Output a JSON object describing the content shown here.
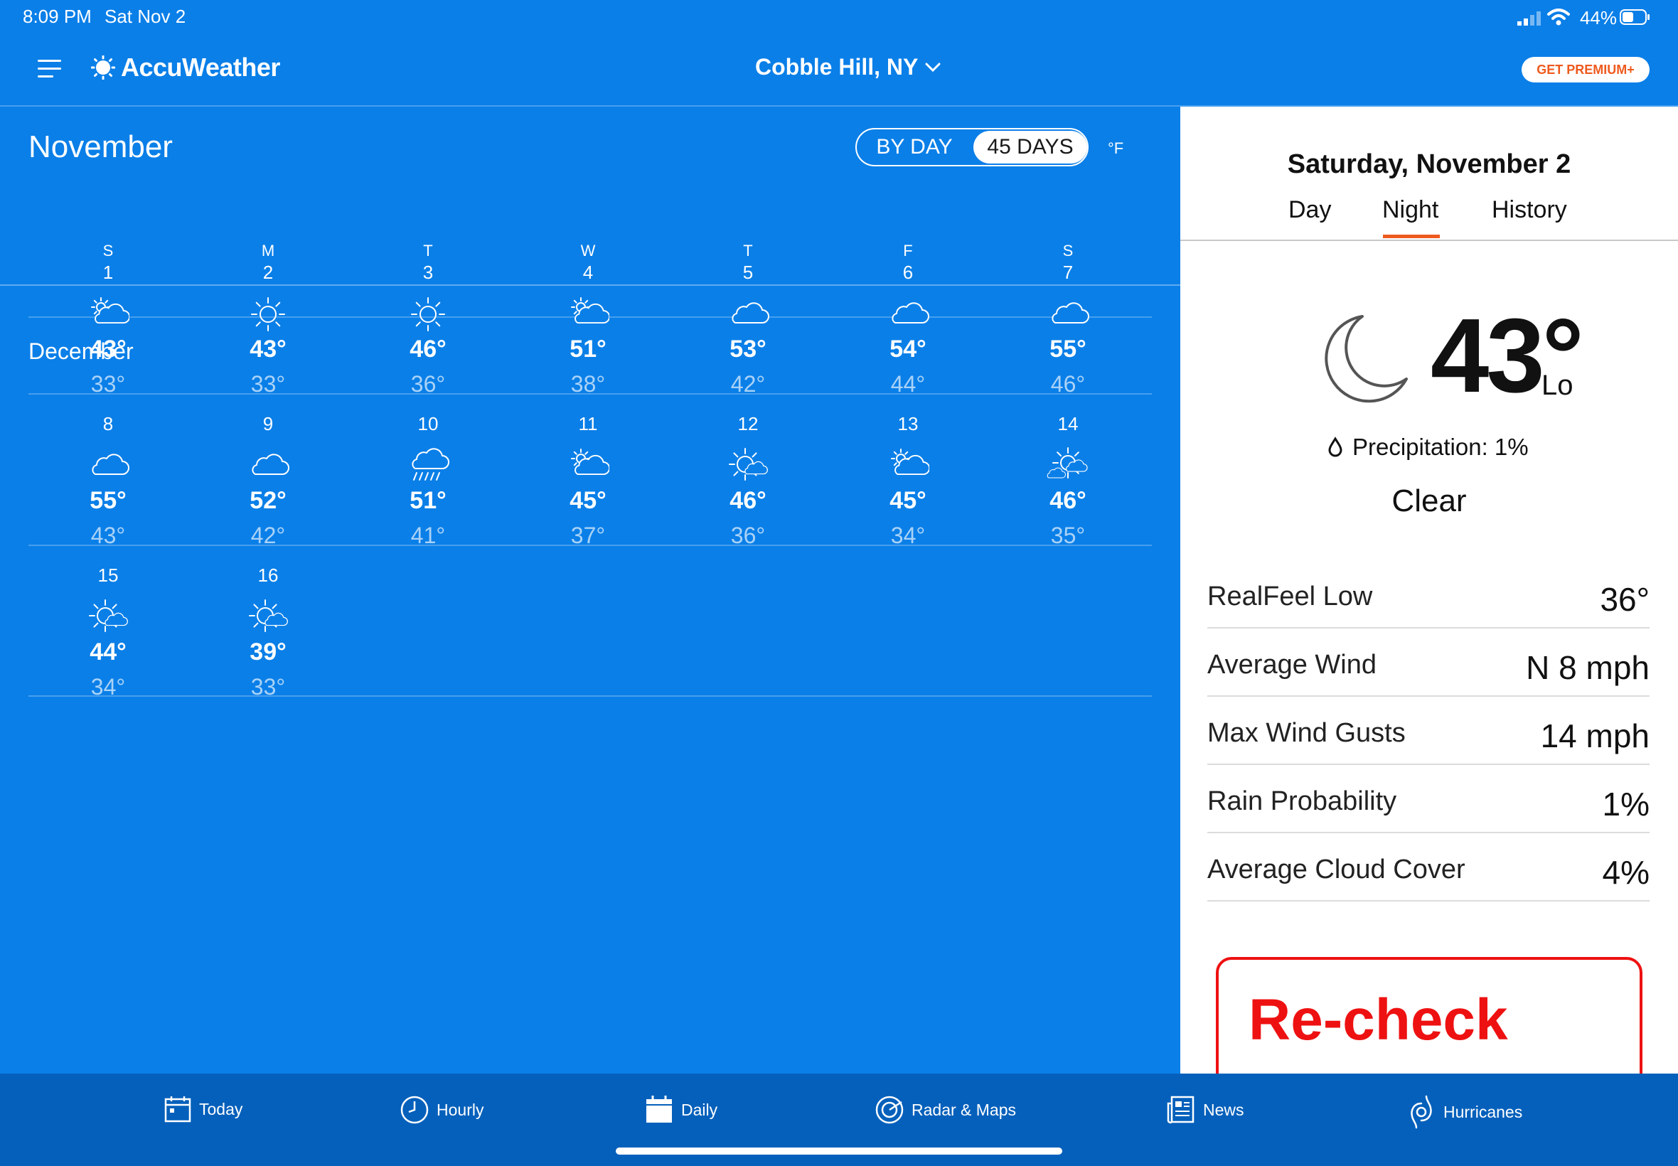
{
  "status_bar": {
    "time": "8:09 PM",
    "date": "Sat Nov 2",
    "battery": "44%"
  },
  "header": {
    "brand": "AccuWeather",
    "location": "Cobble Hill, NY",
    "premium_label": "GET PREMIUM+"
  },
  "calendar": {
    "month_title": "November",
    "toggle": {
      "by_day": "BY DAY",
      "days45": "45 DAYS",
      "selected": "45 DAYS"
    },
    "unit": "°F",
    "weekdays": [
      "S",
      "M",
      "T",
      "W",
      "T",
      "F",
      "S"
    ],
    "december_title": "December",
    "days": [
      {
        "day": "1",
        "icon": "partly-cloudy-icon",
        "hi": "43°",
        "lo": "33°"
      },
      {
        "day": "2",
        "icon": "sunny-icon",
        "hi": "43°",
        "lo": "33°"
      },
      {
        "day": "3",
        "icon": "sunny-icon",
        "hi": "46°",
        "lo": "36°"
      },
      {
        "day": "4",
        "icon": "partly-cloudy-icon",
        "hi": "51°",
        "lo": "38°"
      },
      {
        "day": "5",
        "icon": "cloudy-icon",
        "hi": "53°",
        "lo": "42°"
      },
      {
        "day": "6",
        "icon": "cloudy-icon",
        "hi": "54°",
        "lo": "44°"
      },
      {
        "day": "7",
        "icon": "cloudy-icon",
        "hi": "55°",
        "lo": "46°"
      },
      {
        "day": "8",
        "icon": "cloudy-icon",
        "hi": "55°",
        "lo": "43°"
      },
      {
        "day": "9",
        "icon": "cloudy-icon",
        "hi": "52°",
        "lo": "42°"
      },
      {
        "day": "10",
        "icon": "rain-icon",
        "hi": "51°",
        "lo": "41°"
      },
      {
        "day": "11",
        "icon": "partly-cloudy-icon",
        "hi": "45°",
        "lo": "37°"
      },
      {
        "day": "12",
        "icon": "mostly-sunny-icon",
        "hi": "46°",
        "lo": "36°"
      },
      {
        "day": "13",
        "icon": "partly-cloudy-icon",
        "hi": "45°",
        "lo": "34°"
      },
      {
        "day": "14",
        "icon": "sun-clouds-icon",
        "hi": "46°",
        "lo": "35°"
      },
      {
        "day": "15",
        "icon": "mostly-sunny-icon",
        "hi": "44°",
        "lo": "34°"
      },
      {
        "day": "16",
        "icon": "mostly-sunny-icon",
        "hi": "39°",
        "lo": "33°"
      }
    ]
  },
  "detail": {
    "date": "Saturday, November 2",
    "tabs": [
      "Day",
      "Night",
      "History"
    ],
    "active_tab": "Night",
    "temp": "43°",
    "temp_label": "Lo",
    "precip": "Precipitation: 1%",
    "condition": "Clear",
    "rows": [
      {
        "label": "RealFeel Low",
        "value": "36°"
      },
      {
        "label": "Average Wind",
        "value": "N 8 mph"
      },
      {
        "label": "Max Wind Gusts",
        "value": "14 mph"
      },
      {
        "label": "Rain Probability",
        "value": "1%"
      },
      {
        "label": "Average Cloud Cover",
        "value": "4%"
      }
    ],
    "promo_text": "Re-check"
  },
  "nav": {
    "items": [
      {
        "label": "Today",
        "icon": "calendar-icon"
      },
      {
        "label": "Hourly",
        "icon": "clock-icon"
      },
      {
        "label": "Daily",
        "icon": "calendar-filled-icon"
      },
      {
        "label": "Radar & Maps",
        "icon": "radar-icon"
      },
      {
        "label": "News",
        "icon": "news-icon"
      },
      {
        "label": "Hurricanes",
        "icon": "hurricane-icon"
      }
    ],
    "active": "Daily"
  },
  "colors": {
    "primary_blue": "#0a7fe8",
    "nav_blue": "#0560bb",
    "accent_orange": "#ee5a1e",
    "promo_red": "#ee1111"
  }
}
